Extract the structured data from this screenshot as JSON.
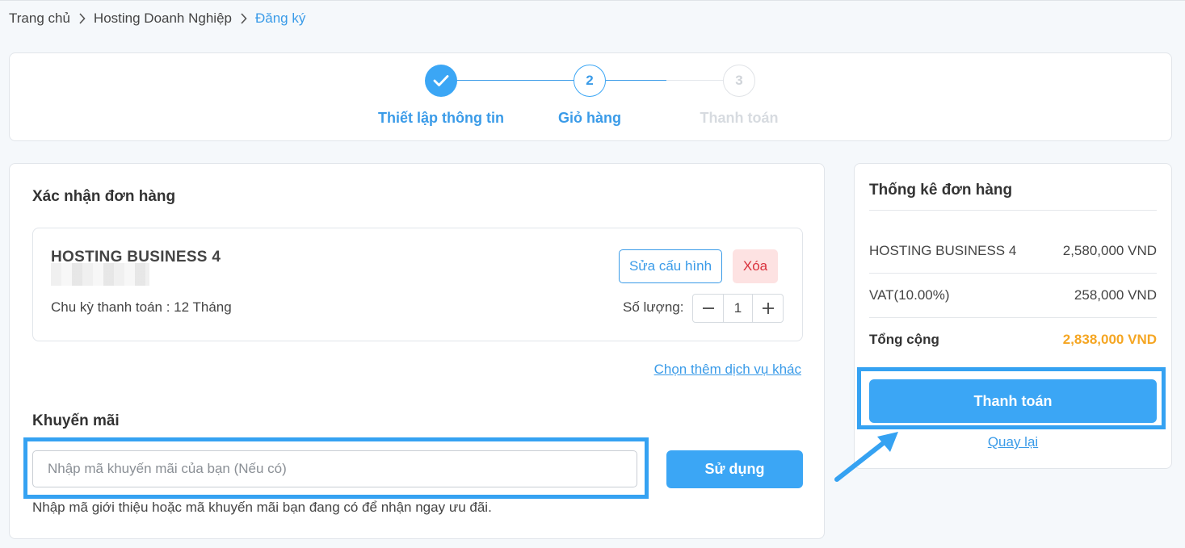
{
  "breadcrumb": {
    "home": "Trang chủ",
    "category": "Hosting Doanh Nghiệp",
    "current": "Đăng ký"
  },
  "steps": [
    {
      "number": "1",
      "label": "Thiết lập thông tin",
      "state": "completed"
    },
    {
      "number": "2",
      "label": "Giỏ hàng",
      "state": "active"
    },
    {
      "number": "3",
      "label": "Thanh toán",
      "state": "upcoming"
    }
  ],
  "order": {
    "title": "Xác nhận đơn hàng",
    "product": {
      "name": "HOSTING BUSINESS 4",
      "cycle_label": "Chu kỳ thanh toán : 12 Tháng",
      "edit_label": "Sửa cấu hình",
      "delete_label": "Xóa",
      "quantity_label": "Số lượng:",
      "quantity": "1"
    },
    "more_services_link": "Chọn thêm dịch vụ khác"
  },
  "promo": {
    "title": "Khuyến mãi",
    "placeholder": "Nhập mã khuyến mãi của bạn (Nếu có)",
    "apply_label": "Sử dụng",
    "hint": "Nhập mã giới thiệu hoặc mã khuyến mãi bạn đang có để nhận ngay ưu đãi."
  },
  "summary": {
    "title": "Thống kê đơn hàng",
    "rows": [
      {
        "label": "HOSTING BUSINESS 4",
        "value": "2,580,000 VND"
      },
      {
        "label": "VAT(10.00%)",
        "value": "258,000 VND"
      }
    ],
    "total_label": "Tổng cộng",
    "total_value": "2,838,000 VND",
    "pay_label": "Thanh toán",
    "back_label": "Quay lại"
  },
  "colors": {
    "primary": "#3ba6f5",
    "link": "#3a9be8",
    "highlight": "#35a2f2",
    "total": "#f5a623",
    "delete_bg": "#fde2e2",
    "delete_text": "#d9303b",
    "step_upcoming": "#d0d4d9"
  },
  "icons": {
    "breadcrumb_separator": "chevron-right-icon",
    "completed_step": "check-icon",
    "qty_minus": "minus-icon",
    "qty_plus": "plus-icon",
    "annotation": "arrow-icon"
  }
}
